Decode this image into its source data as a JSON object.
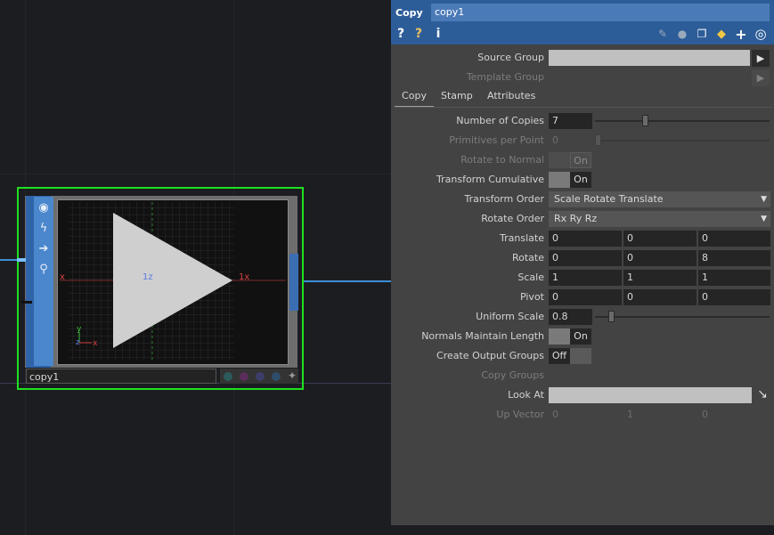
{
  "node": {
    "name": "copy1",
    "viewer": {
      "axis_x_neg": "x",
      "axis_x_pos": "1x",
      "axis_z": "1z",
      "gizmo_y": "y",
      "gizmo_z": "z",
      "gizmo_x": "x"
    }
  },
  "panel": {
    "type": "Copy",
    "name": "copy1",
    "tabs": [
      "Copy",
      "Stamp",
      "Attributes"
    ],
    "active_tab": "Copy",
    "source_group": {
      "label": "Source Group",
      "value": ""
    },
    "template_group": {
      "label": "Template Group",
      "value": ""
    },
    "number_of_copies": {
      "label": "Number of Copies",
      "value": "7",
      "slider_fraction": 0.28
    },
    "primitives_per_point": {
      "label": "Primitives per Point",
      "value": "0",
      "slider_fraction": 0.0
    },
    "rotate_to_normal": {
      "label": "Rotate to Normal",
      "value": "On"
    },
    "transform_cumulative": {
      "label": "Transform Cumulative",
      "value": "On"
    },
    "transform_order": {
      "label": "Transform Order",
      "value": "Scale Rotate Translate"
    },
    "rotate_order": {
      "label": "Rotate Order",
      "value": "Rx Ry Rz"
    },
    "translate": {
      "label": "Translate",
      "values": [
        "0",
        "0",
        "0"
      ]
    },
    "rotate": {
      "label": "Rotate",
      "values": [
        "0",
        "0",
        "8"
      ]
    },
    "scale": {
      "label": "Scale",
      "values": [
        "1",
        "1",
        "1"
      ]
    },
    "pivot": {
      "label": "Pivot",
      "values": [
        "0",
        "0",
        "0"
      ]
    },
    "uniform_scale": {
      "label": "Uniform Scale",
      "value": "0.8",
      "slider_fraction": 0.08
    },
    "normals_maintain_length": {
      "label": "Normals Maintain Length",
      "value": "On"
    },
    "create_output_groups": {
      "label": "Create Output Groups",
      "value": "Off"
    },
    "copy_groups": {
      "label": "Copy Groups"
    },
    "look_at": {
      "label": "Look At",
      "value": ""
    },
    "up_vector": {
      "label": "Up Vector",
      "values": [
        "0",
        "1",
        "0"
      ]
    }
  },
  "colors": {
    "selection": "#1fe01f",
    "header": "#2d5d98",
    "panel_bg": "#434343",
    "wire": "#3d8fd6"
  }
}
